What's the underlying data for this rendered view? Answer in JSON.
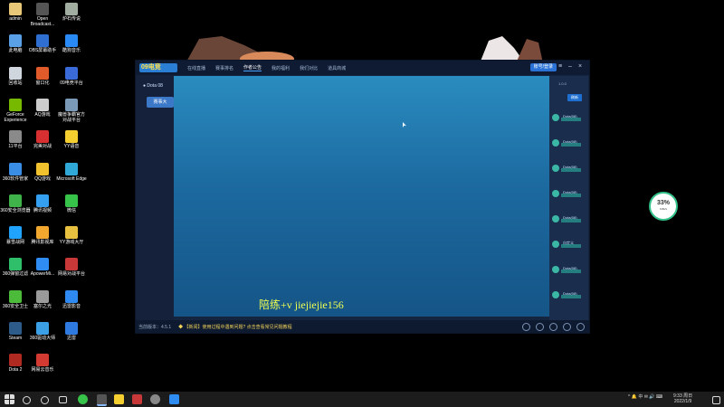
{
  "desktop": {
    "icons_col1": [
      {
        "label": "admin",
        "color": "#e8c878"
      },
      {
        "label": "此电脑",
        "color": "#5aa0e6"
      },
      {
        "label": "回收站",
        "color": "#cfd6de"
      },
      {
        "label": "GeForce Experience",
        "color": "#76b900"
      },
      {
        "label": "11平台",
        "color": "#8a8a8a"
      },
      {
        "label": "360软件管家",
        "color": "#3a8ee6"
      },
      {
        "label": "360安全浏览器",
        "color": "#3fb24a"
      },
      {
        "label": "暴雪战网",
        "color": "#1fa3ff"
      },
      {
        "label": "360弹窗过滤",
        "color": "#2fbf6a"
      },
      {
        "label": "360安全卫士",
        "color": "#4dbb3a"
      },
      {
        "label": "Steam",
        "color": "#2d5b8a"
      },
      {
        "label": "Dota 2",
        "color": "#b02a22"
      }
    ],
    "icons_col2": [
      {
        "label": "Open Broadcast...",
        "color": "#555"
      },
      {
        "label": "OBS屏幕助手",
        "color": "#2e6fd1"
      },
      {
        "label": "窗口化",
        "color": "#e05a2a"
      },
      {
        "label": "AQ游戏",
        "color": "#ccc"
      },
      {
        "label": "完美对战",
        "color": "#d83030"
      },
      {
        "label": "QQ游戏",
        "color": "#f2c12e"
      },
      {
        "label": "腾讯视频",
        "color": "#35a0f2"
      },
      {
        "label": "腾讯影视库",
        "color": "#f2a82e"
      },
      {
        "label": "ApowerMi...",
        "color": "#2e8cf2"
      },
      {
        "label": "塞尔之光",
        "color": "#9a9a9a"
      },
      {
        "label": "360驱动大师",
        "color": "#3ba0e6"
      },
      {
        "label": "网易云音乐",
        "color": "#d33a31"
      }
    ],
    "icons_col3": [
      {
        "label": "炉石传说",
        "color": "#a0ada0"
      },
      {
        "label": "酷狗音乐",
        "color": "#2a8af5"
      },
      {
        "label": "09电竞平台",
        "color": "#3a6ad8"
      },
      {
        "label": "魔兽争霸官方对战平台",
        "color": "#7a9ab8"
      },
      {
        "label": "YY语音",
        "color": "#f5cf2f"
      },
      {
        "label": "Microsoft Edge",
        "color": "#30a8d8"
      },
      {
        "label": "微信",
        "color": "#37c24a"
      },
      {
        "label": "YY游戏大厅",
        "color": "#e8c040"
      },
      {
        "label": "网易对战平台",
        "color": "#c83838"
      },
      {
        "label": "迅雷影音",
        "color": "#2e8af0"
      },
      {
        "label": "迅雷",
        "color": "#2e7ae0"
      }
    ]
  },
  "window": {
    "logo": "09电竞",
    "tabs": [
      "在线直播",
      "赛事排名",
      "作者公告",
      "我的福利",
      "我们对比",
      "道具商城"
    ],
    "login_button": "账号/登录",
    "controls": {
      "menu": "≡",
      "minimize": "–",
      "maximize": "□",
      "close": "×"
    },
    "left_header": "● Dota 08",
    "left_banner": "赛事大",
    "watermark": "陪练+v  jiejiejie156",
    "right_version": "1.0.0",
    "right_button": "刷新",
    "right_rows": [
      "Dota(08)",
      "Dota(08)",
      "Dota(08)",
      "Dota(08)",
      "Dota(08)",
      "自定义",
      "Dota(08)",
      "Dota(08)"
    ],
    "status_version": "当前版本：4.5.1",
    "status_news": "◆ 【新闻】使用过程中遇到问题? 点击查看常见问题教程"
  },
  "gauge": {
    "value": "33%",
    "sub": "0.8k/s"
  },
  "taskbar": {
    "tray_text": "^ 🔔 中 ✉ 🔊 ⌨",
    "time": "9:33 周日",
    "date": "2022/1/9"
  },
  "colors": {
    "window_bg": "#152540",
    "main_gradient_top": "#2a8cc0",
    "accent": "#2a72d6",
    "watermark": "#f0ff50"
  }
}
